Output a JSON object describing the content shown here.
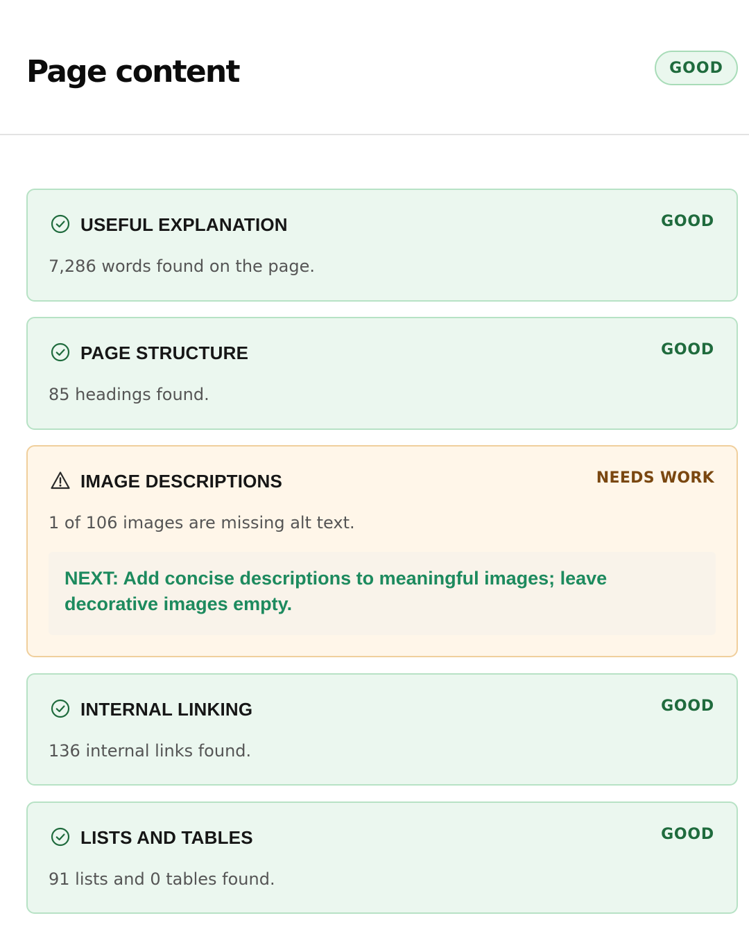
{
  "header": {
    "title": "Page content",
    "badge": "GOOD"
  },
  "colors": {
    "good_text": "#1f6b3d",
    "good_bg": "#ebf7ef",
    "good_border": "#b7e2c5",
    "warn_text": "#7a4710",
    "warn_bg": "#fff6e9",
    "warn_border": "#f0cf9c",
    "next_text": "#1d8a5e"
  },
  "checks": [
    {
      "icon": "check-circle-icon",
      "title": "USEFUL EXPLANATION",
      "status": "GOOD",
      "description": "7,286 words found on the page."
    },
    {
      "icon": "check-circle-icon",
      "title": "PAGE STRUCTURE",
      "status": "GOOD",
      "description": "85 headings found."
    },
    {
      "icon": "warning-triangle-icon",
      "title": "IMAGE DESCRIPTIONS",
      "status": "NEEDS WORK",
      "description": "1 of 106 images are missing alt text.",
      "next": "NEXT: Add concise descriptions to meaningful images; leave decorative images empty."
    },
    {
      "icon": "check-circle-icon",
      "title": "INTERNAL LINKING",
      "status": "GOOD",
      "description": "136 internal links found."
    },
    {
      "icon": "check-circle-icon",
      "title": "LISTS AND TABLES",
      "status": "GOOD",
      "description": "91 lists and 0 tables found."
    }
  ]
}
